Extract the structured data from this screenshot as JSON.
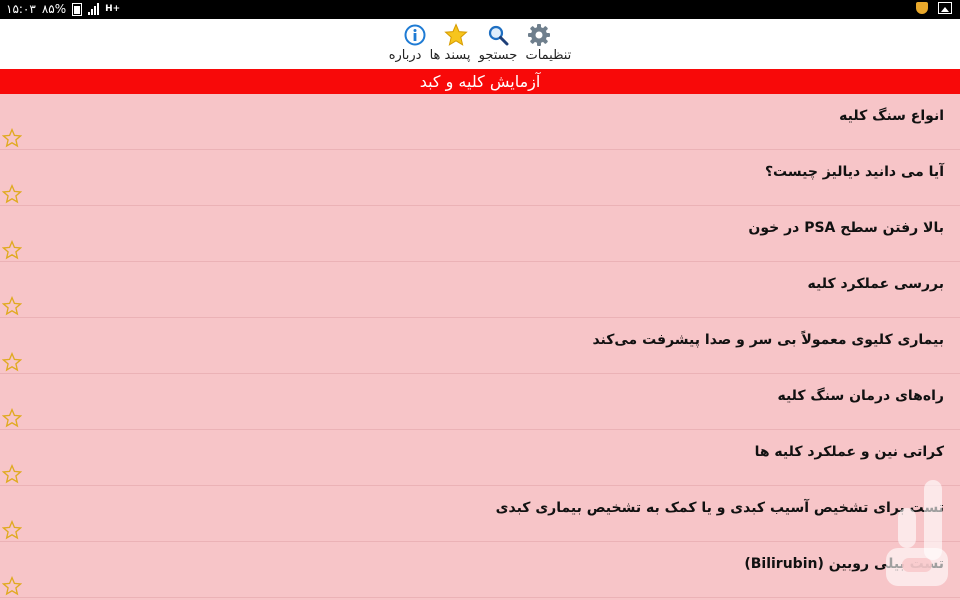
{
  "status_bar": {
    "time": "۱۵:۰۳",
    "battery": "۸۵%",
    "network": "H+"
  },
  "toolbar": {
    "settings_label": "تنظیمات",
    "search_label": "جستجو",
    "favorites_label": "پسند ها",
    "about_label": "درباره"
  },
  "header": {
    "title": "آزمایش کلیه و کبد"
  },
  "list": {
    "items": [
      {
        "title": "انواع سنگ کلیه"
      },
      {
        "title": "آیا می دانید دیالیز چیست؟"
      },
      {
        "title": "بالا رفتن سطح PSA در خون"
      },
      {
        "title": "بررسی عملکرد کلیه"
      },
      {
        "title": "بیماری کلیوی معمولاً بی سر و صدا پیشرفت می‌کند"
      },
      {
        "title": "راه‌های درمان سنگ کلیه"
      },
      {
        "title": "کراتی نین و عملکرد کلیه ها"
      },
      {
        "title": "تست برای تشخیص آسیب کبدی و یا کمک به تشخیص بیماری کبدی"
      },
      {
        "title": "تست بیلی روبین (Bilirubin)"
      }
    ]
  },
  "colors": {
    "header_bg": "#f80909",
    "list_bg": "#f7c5c8",
    "star": "#f2c23a"
  }
}
